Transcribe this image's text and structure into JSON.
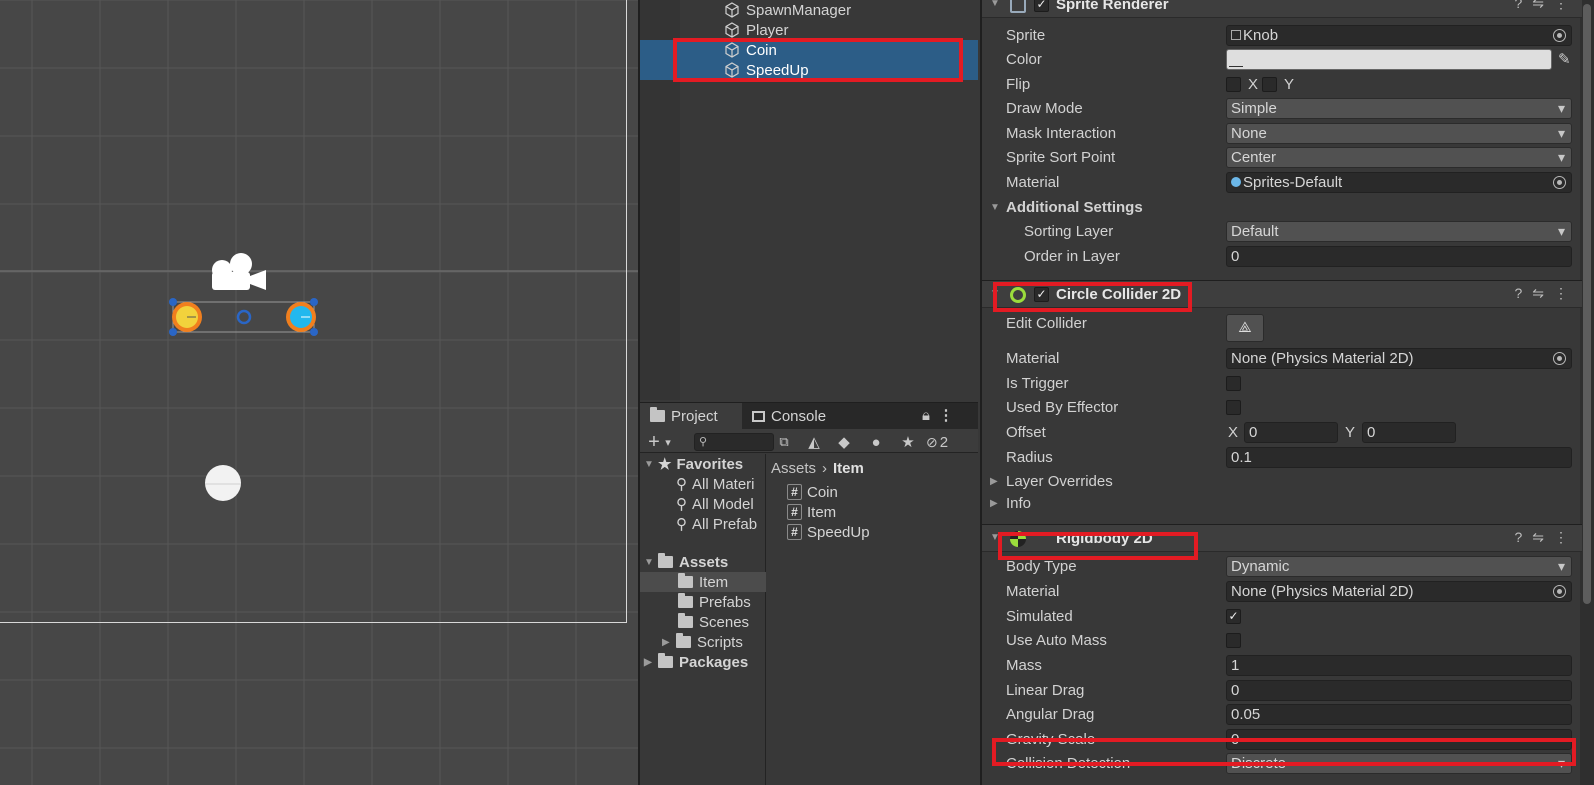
{
  "hierarchy": {
    "items": [
      {
        "label": "SpawnManager",
        "selected": false
      },
      {
        "label": "Player",
        "selected": false
      },
      {
        "label": "Coin",
        "selected": true
      },
      {
        "label": "SpeedUp",
        "selected": true
      }
    ]
  },
  "project": {
    "tabs": [
      "Project",
      "Console"
    ],
    "hidden_count": "2",
    "favorites_label": "Favorites",
    "favorites": [
      "All Materi",
      "All Model",
      "All Prefab"
    ],
    "assets_label": "Assets",
    "asset_folders": [
      "Item",
      "Prefabs",
      "Scenes",
      "Scripts"
    ],
    "packages_label": "Packages",
    "breadcrumb_root": "Assets",
    "breadcrumb_current": "Item",
    "files": [
      "Coin",
      "Item",
      "SpeedUp"
    ]
  },
  "inspector": {
    "sprite_renderer": {
      "title": "Sprite Renderer",
      "sprite_label": "Sprite",
      "sprite_value": "Knob",
      "color_label": "Color",
      "flip_label": "Flip",
      "flip_x": "X",
      "flip_y": "Y",
      "draw_mode_label": "Draw Mode",
      "draw_mode_value": "Simple",
      "mask_label": "Mask Interaction",
      "mask_value": "None",
      "sort_point_label": "Sprite Sort Point",
      "sort_point_value": "Center",
      "material_label": "Material",
      "material_value": "Sprites-Default",
      "additional_label": "Additional Settings",
      "sorting_layer_label": "Sorting Layer",
      "sorting_layer_value": "Default",
      "order_label": "Order in Layer",
      "order_value": "0"
    },
    "circle_collider": {
      "title": "Circle Collider 2D",
      "edit_label": "Edit Collider",
      "material_label": "Material",
      "material_value": "None (Physics Material 2D)",
      "trigger_label": "Is Trigger",
      "effector_label": "Used By Effector",
      "offset_label": "Offset",
      "offset_x_label": "X",
      "offset_x": "0",
      "offset_y_label": "Y",
      "offset_y": "0",
      "radius_label": "Radius",
      "radius_value": "0.1",
      "layer_overrides_label": "Layer Overrides",
      "info_label": "Info"
    },
    "rigidbody": {
      "title": "Rigidbody 2D",
      "body_type_label": "Body Type",
      "body_type_value": "Dynamic",
      "material_label": "Material",
      "material_value": "None (Physics Material 2D)",
      "simulated_label": "Simulated",
      "auto_mass_label": "Use Auto Mass",
      "mass_label": "Mass",
      "mass_value": "1",
      "linear_drag_label": "Linear Drag",
      "linear_drag_value": "0",
      "angular_drag_label": "Angular Drag",
      "angular_drag_value": "0.05",
      "gravity_label": "Gravity Scale",
      "gravity_value": "0",
      "collision_label": "Collision Detection",
      "collision_value": "Discrete"
    }
  },
  "colors": {
    "selection": "#2c5d87",
    "highlight_box": "#e31b23",
    "coin": "#f2d23c",
    "speedup": "#22b8ee"
  }
}
